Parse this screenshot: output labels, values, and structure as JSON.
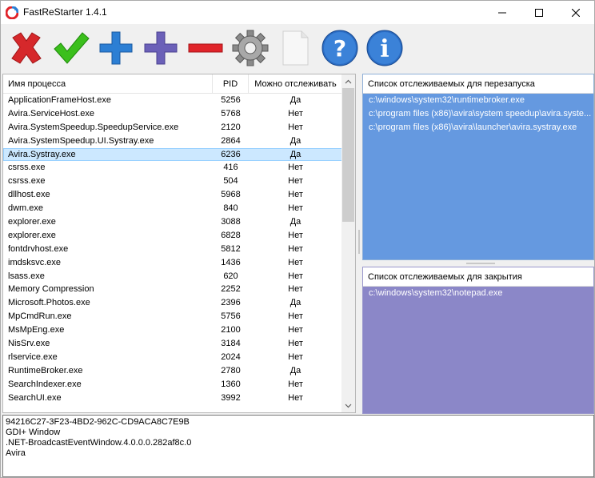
{
  "window": {
    "title": "FastReStarter 1.4.1"
  },
  "toolbar": {
    "buttons": [
      {
        "icon": "red-x-icon",
        "color": "#d6282b"
      },
      {
        "icon": "green-check-icon",
        "color": "#32b418"
      },
      {
        "icon": "blue-plus-icon",
        "color": "#2c7fd4"
      },
      {
        "icon": "purple-plus-icon",
        "color": "#6b60b8"
      },
      {
        "icon": "red-minus-icon",
        "color": "#e0242a"
      },
      {
        "icon": "gear-icon",
        "color": "#8a8a8a"
      },
      {
        "icon": "blank-page-icon",
        "color": "#f2f2f2"
      },
      {
        "icon": "help-icon",
        "color": "#2a6cc4"
      },
      {
        "icon": "info-icon",
        "color": "#2a6cc4"
      }
    ]
  },
  "process_table": {
    "columns": [
      "Имя процесса",
      "PID",
      "Можно отслеживать"
    ],
    "rows": [
      {
        "name": "ApplicationFrameHost.exe",
        "pid": "5256",
        "track": "Да"
      },
      {
        "name": "Avira.ServiceHost.exe",
        "pid": "5768",
        "track": "Нет"
      },
      {
        "name": "Avira.SystemSpeedup.SpeedupService.exe",
        "pid": "2120",
        "track": "Нет"
      },
      {
        "name": "Avira.SystemSpeedup.UI.Systray.exe",
        "pid": "2864",
        "track": "Да"
      },
      {
        "name": "Avira.Systray.exe",
        "pid": "6236",
        "track": "Да",
        "selected": true
      },
      {
        "name": "csrss.exe",
        "pid": "416",
        "track": "Нет"
      },
      {
        "name": "csrss.exe",
        "pid": "504",
        "track": "Нет"
      },
      {
        "name": "dllhost.exe",
        "pid": "5968",
        "track": "Нет"
      },
      {
        "name": "dwm.exe",
        "pid": "840",
        "track": "Нет"
      },
      {
        "name": "explorer.exe",
        "pid": "3088",
        "track": "Да"
      },
      {
        "name": "explorer.exe",
        "pid": "6828",
        "track": "Нет"
      },
      {
        "name": "fontdrvhost.exe",
        "pid": "5812",
        "track": "Нет"
      },
      {
        "name": "imdsksvc.exe",
        "pid": "1436",
        "track": "Нет"
      },
      {
        "name": "lsass.exe",
        "pid": "620",
        "track": "Нет"
      },
      {
        "name": "Memory Compression",
        "pid": "2252",
        "track": "Нет"
      },
      {
        "name": "Microsoft.Photos.exe",
        "pid": "2396",
        "track": "Да"
      },
      {
        "name": "MpCmdRun.exe",
        "pid": "5756",
        "track": "Нет"
      },
      {
        "name": "MsMpEng.exe",
        "pid": "2100",
        "track": "Нет"
      },
      {
        "name": "NisSrv.exe",
        "pid": "3184",
        "track": "Нет"
      },
      {
        "name": "rlservice.exe",
        "pid": "2024",
        "track": "Нет"
      },
      {
        "name": "RuntimeBroker.exe",
        "pid": "2780",
        "track": "Да"
      },
      {
        "name": "SearchIndexer.exe",
        "pid": "1360",
        "track": "Нет"
      },
      {
        "name": "SearchUI.exe",
        "pid": "3992",
        "track": "Нет"
      }
    ]
  },
  "restart_list": {
    "title": "Список отслеживаемых для перезапуска",
    "items": [
      "c:\\windows\\system32\\runtimebroker.exe",
      "c:\\program files (x86)\\avira\\system speedup\\avira.syste...",
      "c:\\program files (x86)\\avira\\launcher\\avira.systray.exe"
    ]
  },
  "close_list": {
    "title": "Список отслеживаемых для закрытия",
    "items": [
      "c:\\windows\\system32\\notepad.exe"
    ]
  },
  "info": {
    "lines": [
      "94216C27-3F23-4BD2-962C-CD9ACA8C7E9B",
      "GDI+ Window",
      ".NET-BroadcastEventWindow.4.0.0.0.282af8c.0",
      "Avira"
    ]
  }
}
